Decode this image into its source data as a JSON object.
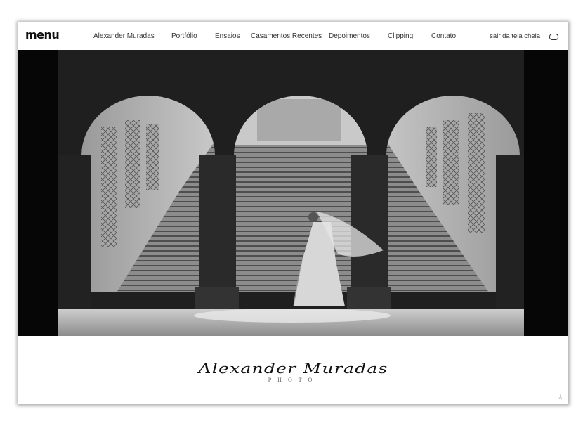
{
  "header": {
    "logo_text": "menu",
    "nav_items": [
      {
        "label": "Alexander Muradas"
      },
      {
        "label": "Portfólio"
      },
      {
        "label": "Ensaios"
      },
      {
        "label": "Casamentos Recentes"
      },
      {
        "label": "Depoimentos"
      },
      {
        "label": "Clipping"
      },
      {
        "label": "Contato"
      }
    ],
    "fullscreen_label": "sair da tela cheia",
    "fullscreen_icon": "fullscreen-toggle-icon"
  },
  "hero": {
    "image_desc_icon": "wedding-photo",
    "colors": {
      "dark": "#050505",
      "stone": "#b9b9b9",
      "floor": "#d8d8d8"
    }
  },
  "footer": {
    "signature_text": "Alexander Muradas",
    "subtitle_text": "PHOTO",
    "corner_icon": "scroll-corner-icon"
  }
}
